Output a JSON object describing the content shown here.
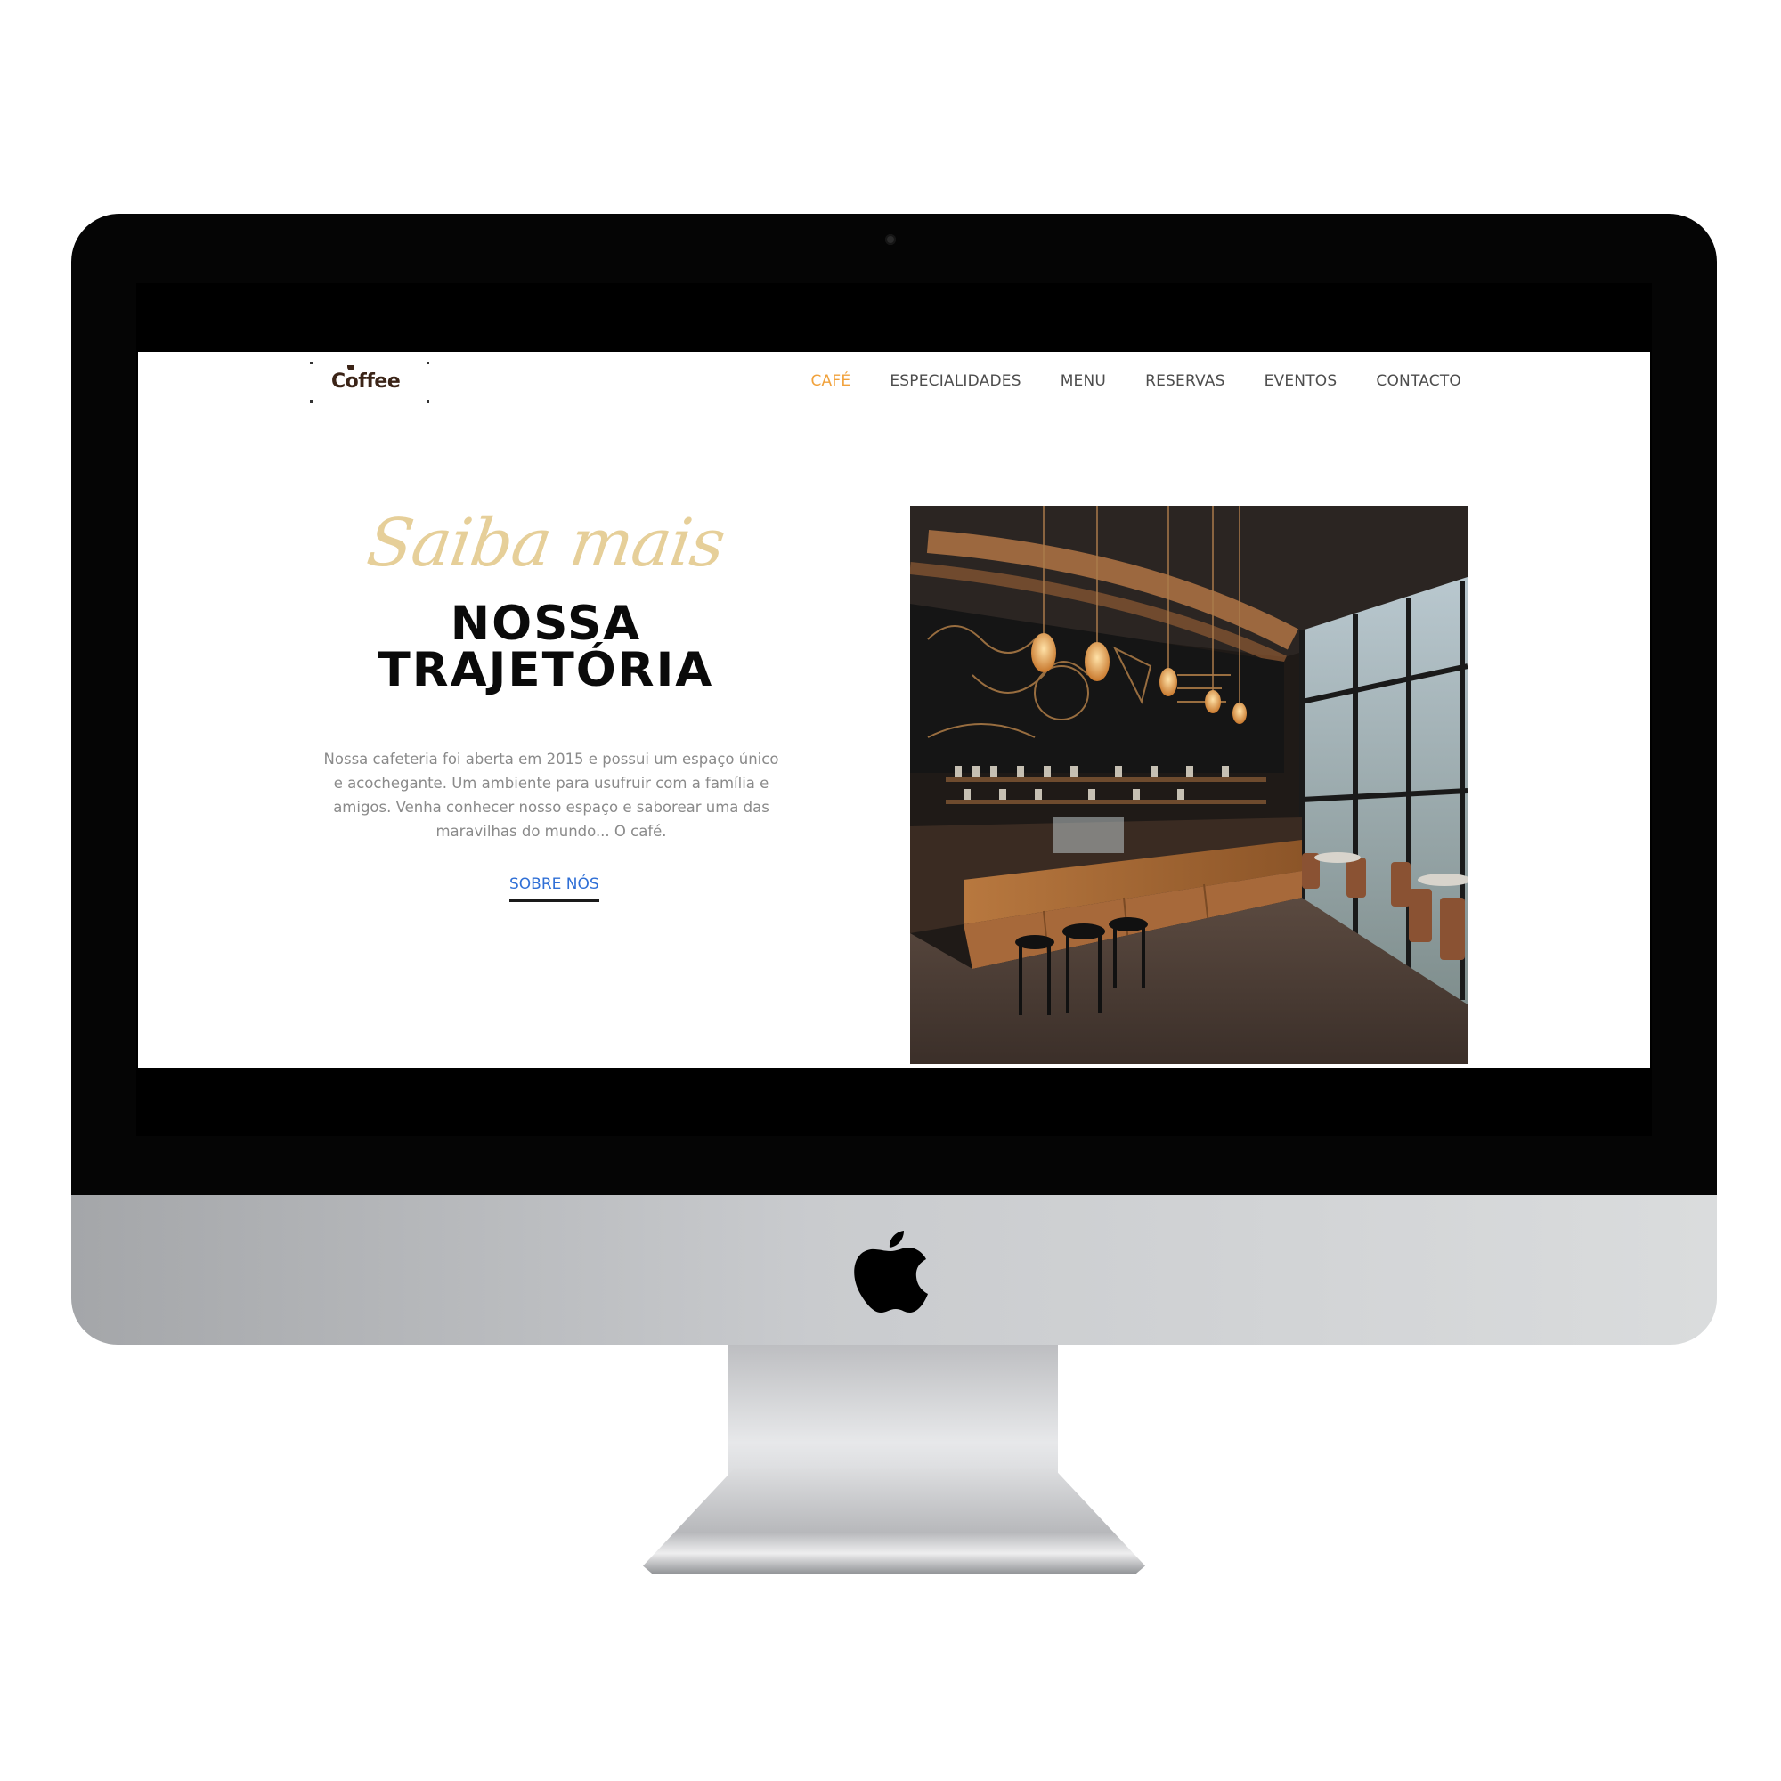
{
  "site": {
    "logo_text": "Coffee",
    "nav": [
      {
        "label": "CAFÉ",
        "active": true
      },
      {
        "label": "ESPECIALIDADES",
        "active": false
      },
      {
        "label": "MENU",
        "active": false
      },
      {
        "label": "RESERVAS",
        "active": false
      },
      {
        "label": "EVENTOS",
        "active": false
      },
      {
        "label": "CONTACTO",
        "active": false
      }
    ],
    "hero": {
      "script_title": "Saiba mais",
      "title_line1": "NOSSA",
      "title_line2": "TRAJETÓRIA",
      "description": "Nossa cafeteria foi aberta em 2015 e possui um espaço único e acochegante. Um ambiente para usufruir com a família e amigos. Venha conhecer nosso espaço e saborear uma das maravilhas do mundo... O café.",
      "cta_label": "SOBRE NÓS"
    }
  },
  "colors": {
    "nav_active": "#f1a23c",
    "script_title": "#e6cf99",
    "cta_link": "#2f6fd6"
  },
  "icons": {
    "device_logo": "apple-logo-icon",
    "camera": "webcam-icon"
  }
}
